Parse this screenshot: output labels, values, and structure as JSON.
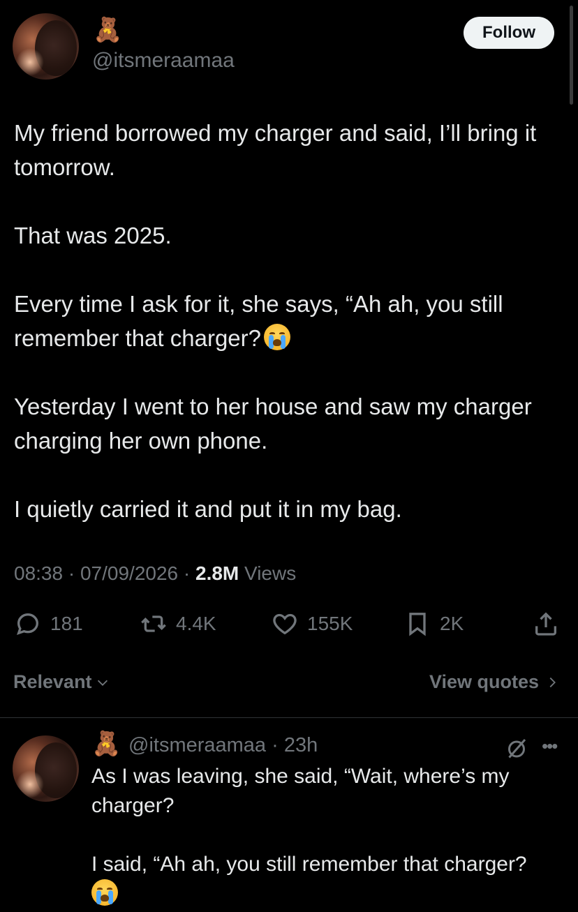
{
  "tweet": {
    "author_emoji": "🧸",
    "handle": "@itsmeraamaa",
    "follow_label": "Follow",
    "paragraphs": [
      "My friend borrowed my charger and said, I’ll bring it tomorrow.",
      "That was 2025.",
      "Every time I ask for it, she says, “Ah ah, you still remember that charger?",
      "Yesterday I went to her house and saw my charger charging her own phone.",
      "I quietly carried it and put it in my bag."
    ],
    "time": "08:38",
    "date": "07/09/2026",
    "views_count": "2.8M",
    "views_label": "Views",
    "separator": "·"
  },
  "actions": {
    "replies": "181",
    "reposts": "4.4K",
    "likes": "155K",
    "bookmarks": "2K"
  },
  "sort": {
    "label": "Relevant",
    "view_quotes_label": "View quotes"
  },
  "reply": {
    "author_emoji": "🧸",
    "handle": "@itsmeraamaa",
    "separator": "·",
    "age": "23h",
    "paragraphs": [
      "As I was leaving, she said, “Wait, where’s my charger?",
      "I said, “Ah ah, you still remember that charger?"
    ]
  },
  "icons": {
    "reply": "reply-icon",
    "repost": "repost-icon",
    "like": "heart-icon",
    "bookmark": "bookmark-icon",
    "share": "share-icon",
    "grok": "grok-icon",
    "more": "more-icon",
    "emoji": "loudly-crying-face-icon"
  },
  "colors": {
    "background": "#000000",
    "text": "#e7e9ea",
    "secondary": "#71767b",
    "follow_bg": "#eff3f4"
  }
}
